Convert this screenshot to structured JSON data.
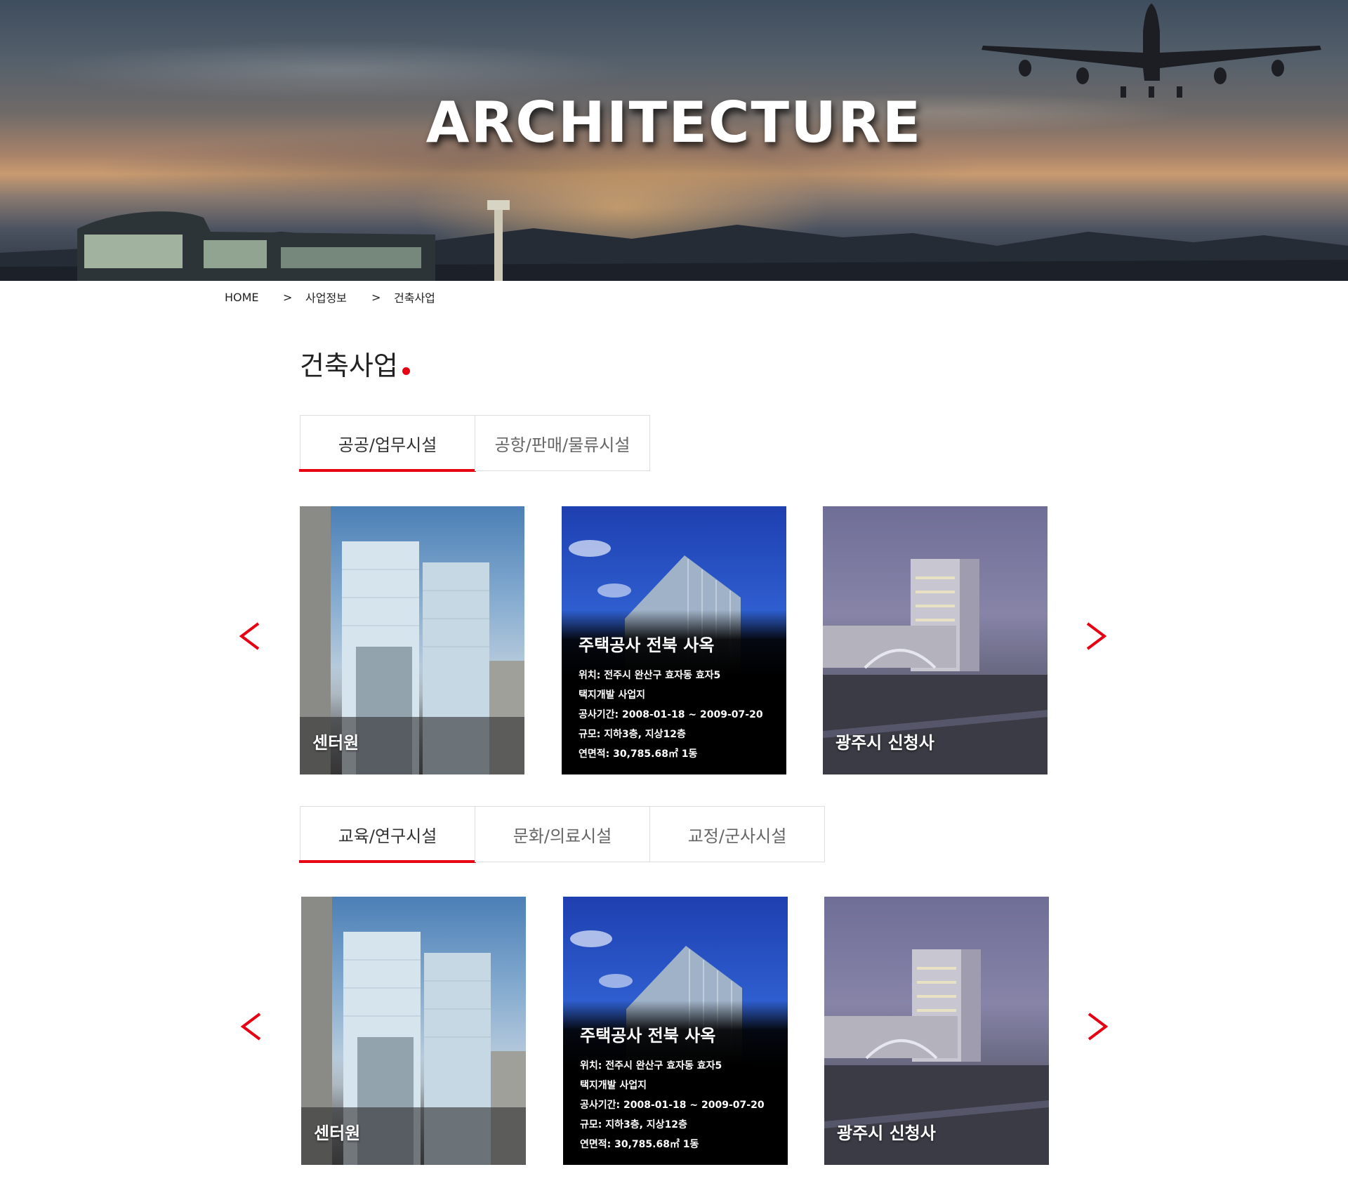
{
  "hero": {
    "title": "ARCHITECTURE"
  },
  "breadcrumb": {
    "home": "HOME",
    "separator": ">",
    "section": "사업정보",
    "current": "건축사업"
  },
  "page": {
    "title": "건축사업",
    "accent_color": "#e60012"
  },
  "tab_group_1": {
    "tabs": [
      {
        "label": "공공/업무시설",
        "active": true
      },
      {
        "label": "공항/판매/물류시설",
        "active": false
      }
    ]
  },
  "tab_group_2": {
    "tabs": [
      {
        "label": "교육/연구시설",
        "active": true
      },
      {
        "label": "문화/의료시설",
        "active": false
      },
      {
        "label": "교정/군사시설",
        "active": false
      }
    ]
  },
  "gallery_1": {
    "prev": "<",
    "next": ">",
    "cards": [
      {
        "name": "센터원"
      },
      {
        "title": "주택공사 전북 사옥",
        "lines": [
          "위치: 전주시 완산구 효자동 효자5",
          "택지개발 사업지",
          "공사기간: 2008-01-18 ~ 2009-07-20",
          "규모: 지하3층, 지상12층",
          "연면적: 30,785.68㎡  1동"
        ]
      },
      {
        "name": "광주시 신청사"
      }
    ]
  },
  "gallery_2": {
    "prev": "<",
    "next": ">",
    "cards": [
      {
        "name": "센터원"
      },
      {
        "title": "주택공사 전북 사옥",
        "lines": [
          "위치: 전주시 완산구 효자동 효자5",
          "택지개발 사업지",
          "공사기간: 2008-01-18 ~ 2009-07-20",
          "규모: 지하3층, 지상12층",
          "연면적: 30,785.68㎡  1동"
        ]
      },
      {
        "name": "광주시 신청사"
      }
    ]
  }
}
